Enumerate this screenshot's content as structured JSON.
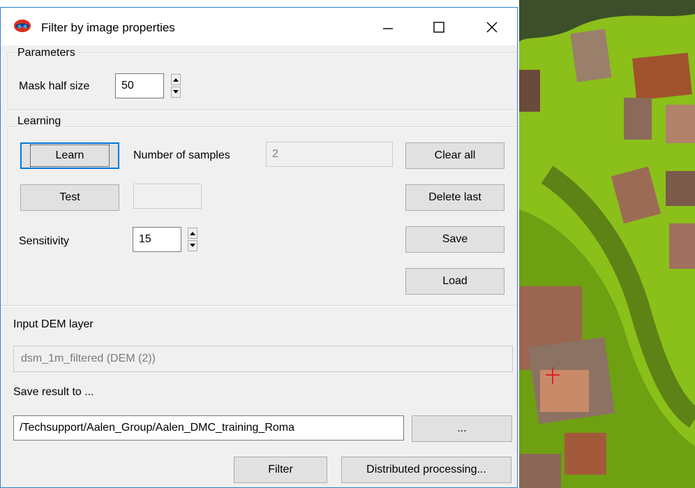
{
  "window": {
    "title": "Filter by image properties"
  },
  "parameters": {
    "group_label": "Parameters",
    "mask_half_size_label": "Mask half size",
    "mask_half_size_value": "50"
  },
  "learning": {
    "group_label": "Learning",
    "learn_label": "Learn",
    "number_of_samples_label": "Number of samples",
    "number_of_samples_value": "2",
    "clear_all_label": "Clear all",
    "test_label": "Test",
    "test_value": "",
    "delete_last_label": "Delete last",
    "sensitivity_label": "Sensitivity",
    "sensitivity_value": "15",
    "save_label": "Save",
    "load_label": "Load"
  },
  "input": {
    "label": "Input DEM layer",
    "value": "dsm_1m_filtered (DEM (2))"
  },
  "output": {
    "label": "Save result to ...",
    "path": "/Techsupport/Aalen_Group/Aalen_DMC_training_Roma",
    "browse_label": "..."
  },
  "footer": {
    "filter_label": "Filter",
    "distributed_label": "Distributed processing..."
  },
  "colors": {
    "accent": "#0078d7",
    "title_border": "#2b7fd6",
    "marker": "#e0202a"
  }
}
